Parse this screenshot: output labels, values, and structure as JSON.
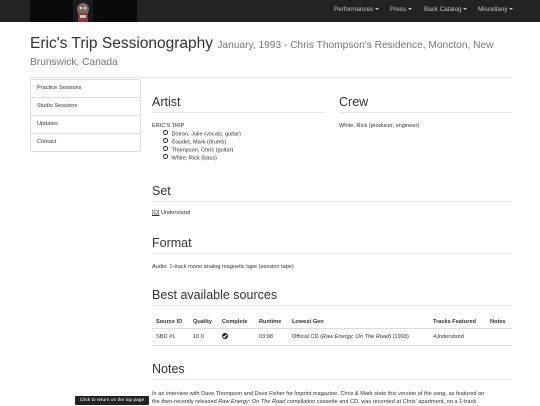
{
  "nav": {
    "items": [
      {
        "label": "Performances"
      },
      {
        "label": "Press"
      },
      {
        "label": "Back Catalog"
      },
      {
        "label": "Miscellany"
      }
    ]
  },
  "header": {
    "title": "Eric's Trip Sessionography",
    "subtitle_inline": "January, 1993 - Chris Thompson's Residence, Moncton, New",
    "subtitle_cont": "Brunswick, Canada"
  },
  "sidebar": {
    "items": [
      {
        "label": "Practice Sessions"
      },
      {
        "label": "Studio Sessions"
      },
      {
        "label": "Updates"
      },
      {
        "label": "Contact"
      }
    ]
  },
  "artist": {
    "heading": "Artist",
    "band": "ERIC'S TRIP",
    "members": [
      "Doiron, Julie (vocals, guitar)",
      "Gaudet, Mark (drums)",
      "Thompson, Chris (guitar)",
      "White, Rick (bass)"
    ]
  },
  "crew": {
    "heading": "Crew",
    "text": "White, Rick (producer, engineer)"
  },
  "set": {
    "heading": "Set",
    "tag": "[Q]",
    "track": "Understand"
  },
  "format": {
    "heading": "Format",
    "text": "Audio: 1-track mono analog magnetic tape (session tape)"
  },
  "sources": {
    "heading": "Best available sources",
    "columns": [
      "Source ID",
      "Quality",
      "Complete",
      "Runtime",
      "Lowest Gen",
      "Tracks Featured",
      "Notes"
    ],
    "rows": [
      {
        "source_id": "SBD #1",
        "quality": "10.0",
        "complete_icon": "check-circle-icon",
        "runtime": "03:08",
        "lowest_gen_prefix": "Official CD (",
        "lowest_gen_title": "Raw Energy: On The Road",
        "lowest_gen_suffix": ") (1993)",
        "tracks_featured": "•Understand",
        "notes": ""
      }
    ]
  },
  "notes": {
    "heading": "Notes",
    "line1_a": "In an interview with Dave Thompson and Dave Fisher for ",
    "line1_pub": "Imprint",
    "line1_b": " magazine, Chris & Mark state this version of the song, as featured on",
    "line2_a": "the then-recently released ",
    "line2_title": "Raw Energy: On The Road",
    "line2_b": " compilation cassette and CD, was recorded at Chris' apartment, on a 1-track"
  },
  "back_to_top": "Click to return on the top page"
}
